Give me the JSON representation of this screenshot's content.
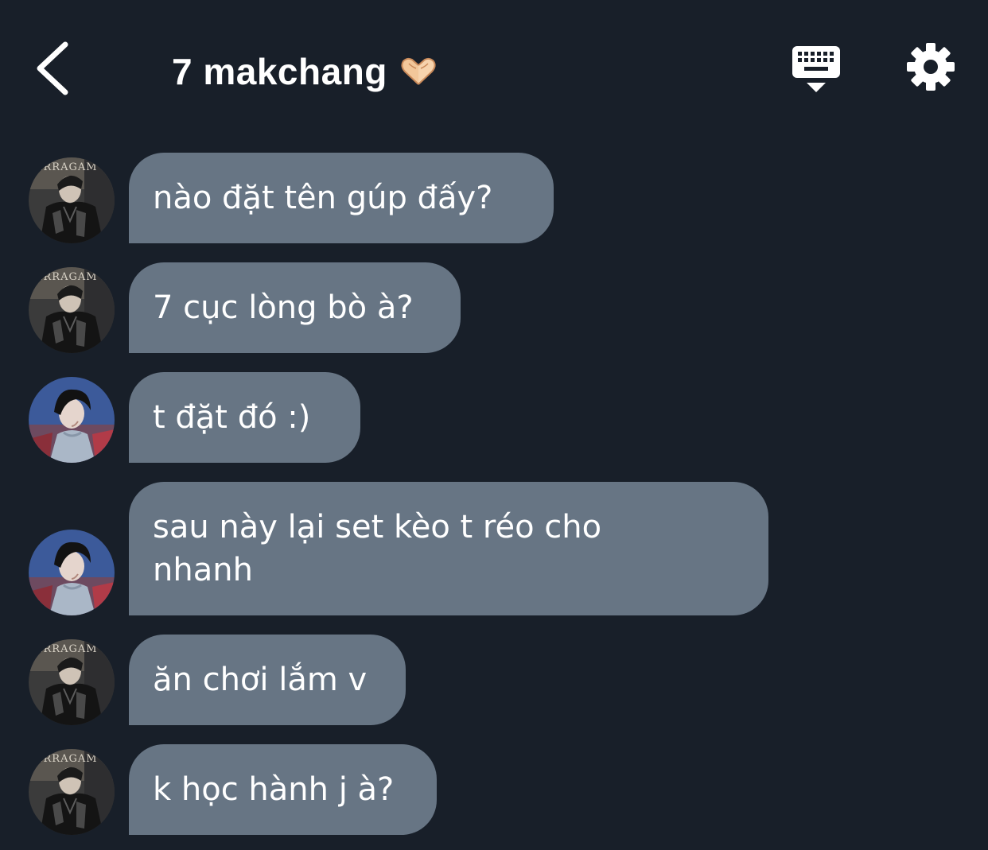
{
  "header": {
    "back_icon": "chevron-left-icon",
    "title": "7 makchang",
    "title_emoji_icon": "heart-hands-icon",
    "keyboard_icon": "keyboard-icon",
    "settings_icon": "gear-icon"
  },
  "colors": {
    "background": "#181f29",
    "bubble": "#677584",
    "text": "#ffffff"
  },
  "messages": [
    {
      "sender_avatar": "avatar-user-a",
      "text": "nào đặt tên gúp đấy?"
    },
    {
      "sender_avatar": "avatar-user-a",
      "text": "7 cục lòng bò à?"
    },
    {
      "sender_avatar": "avatar-user-b",
      "text": "t đặt đó :)"
    },
    {
      "sender_avatar": "avatar-user-b",
      "text": "sau này lại set kèo t réo cho nhanh"
    },
    {
      "sender_avatar": "avatar-user-a",
      "text": "ăn chơi lắm v"
    },
    {
      "sender_avatar": "avatar-user-a",
      "text": "k học hành j à?"
    }
  ]
}
